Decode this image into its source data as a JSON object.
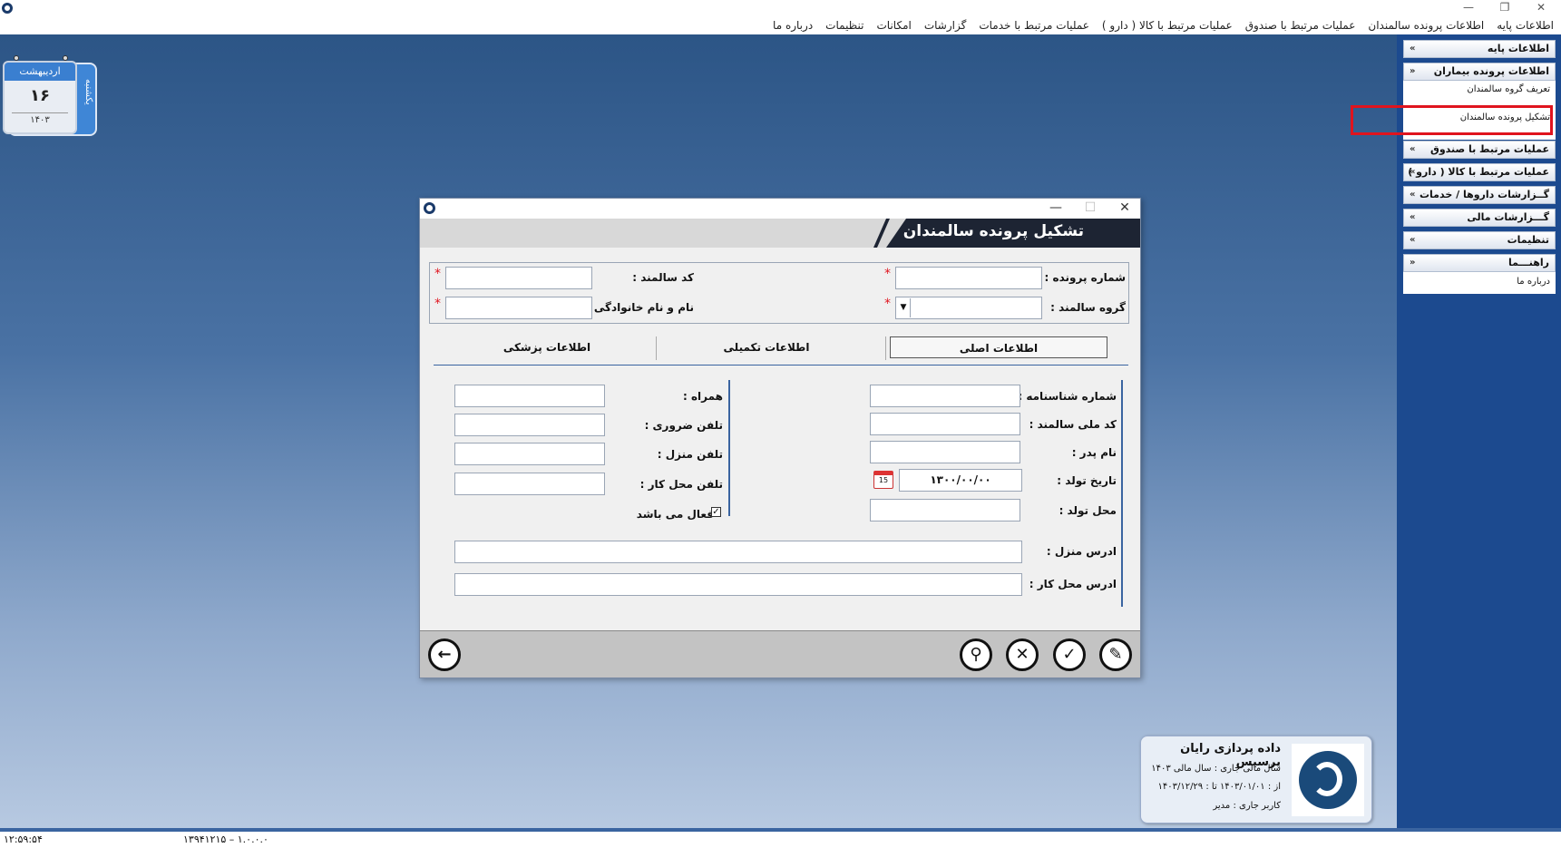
{
  "window": {
    "minimize": "—",
    "restore": "❐",
    "close": "✕"
  },
  "menu": [
    "اطلاعات پایه",
    "اطلاعات پرونده سالمندان",
    "عملیات مرتبط با صندوق",
    "عملیات مرتبط با کالا ( دارو )",
    "عملیات مرتبط با خدمات",
    "گزارشات",
    "امکانات",
    "تنظیمات",
    "درباره ما"
  ],
  "sidebar": {
    "items": [
      {
        "label": "اطلاعات پایه",
        "chevron": "»"
      },
      {
        "label": "اطلاعات پرونده بیماران",
        "chevron": "«"
      },
      {
        "label": "عملیات مرتبط با صندوق",
        "chevron": "»"
      },
      {
        "label": "عملیات مرتبط با کالا ( دارو )",
        "chevron": "»"
      },
      {
        "label": "گــزارشات داروها / خدمات",
        "chevron": "»"
      },
      {
        "label": "گـــزارشات مالی",
        "chevron": "»"
      },
      {
        "label": "تنظیمات",
        "chevron": "»"
      },
      {
        "label": "راهنـــما",
        "chevron": "«"
      }
    ],
    "subitems": {
      "patients_1": "تعریف گروه سالمندان",
      "patients_2": "تشکیل پرونده سالمندان",
      "help_1": "درباره ما"
    }
  },
  "calendar": {
    "month": "اردیبهشت",
    "day": "۱۶",
    "year": "۱۴۰۳",
    "weekday": "یکشنبه"
  },
  "dialog": {
    "title": "تشکیل پرونده سالمندان",
    "minimize": "—",
    "maximize": "☐",
    "close": "✕",
    "fields": {
      "file_number": "شماره پرونده :",
      "elder_code": "کد سالمند :",
      "elder_group": "گروه سالمند :",
      "full_name": "نام و نام خانوادگی :",
      "birth_cert": "شماره شناسنامه :",
      "national_code": "کد ملی سالمند :",
      "father_name": "نام پدر :",
      "birth_date": "تاریخ تولد :",
      "birth_date_value": "۱۳۰۰/۰۰/۰۰",
      "birth_place": "محل تولد :",
      "mobile": "همراه :",
      "emergency_phone": "تلفن ضروری :",
      "home_phone": "تلفن منزل :",
      "work_phone": "تلفن محل کار :",
      "active": "فعال می باشد",
      "home_address": "ادرس منزل :",
      "work_address": "ادرس محل کار :",
      "required_mark": "*",
      "calendar_icon_day": "15"
    },
    "tabs": [
      "اطلاعات اصلی",
      "اطلاعات تکمیلی",
      "اطلاعات پزشکی"
    ],
    "buttons": {
      "back": "←",
      "search": "⚲",
      "cancel": "✕",
      "confirm": "✓",
      "edit": "✎"
    }
  },
  "company": {
    "name": "داده پردازی رایان پرسیس",
    "fiscal_year": "سال مالی جاری  :  سال مالی ۱۴۰۳",
    "range": "از :  ۱۴۰۳/۰۱/۰۱     تا :  ۱۴۰۳/۱۲/۲۹",
    "user": "کاربر جاری :         مدیر"
  },
  "status": {
    "time": "۱۲:۵۹:۵۴",
    "version": "۱۳۹۴۱۲۱۵ – ۱.۰.۰.۰"
  }
}
